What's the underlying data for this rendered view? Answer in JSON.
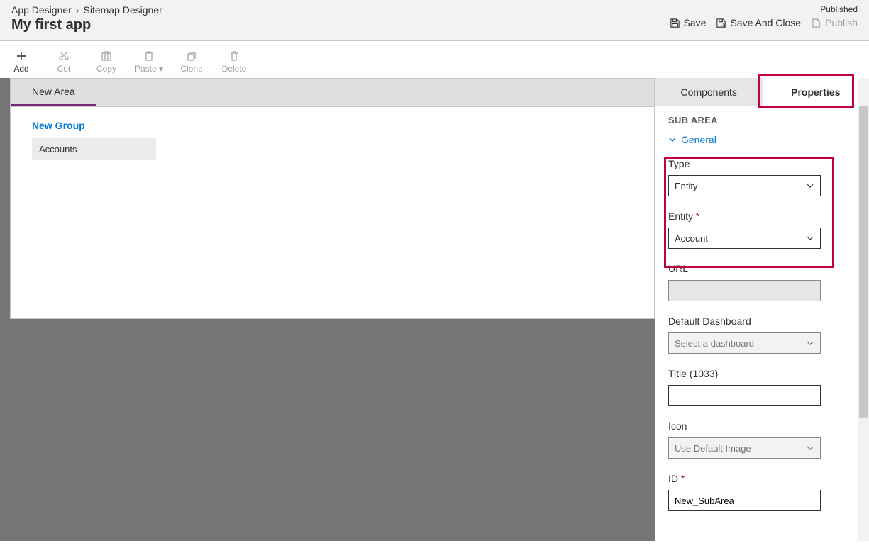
{
  "header": {
    "breadcrumb": [
      "App Designer",
      "Sitemap Designer"
    ],
    "app_title": "My first app",
    "status": "Published",
    "actions": {
      "save": "Save",
      "save_close": "Save And Close",
      "publish": "Publish"
    }
  },
  "toolbar": {
    "add": "Add",
    "cut": "Cut",
    "copy": "Copy",
    "paste": "Paste",
    "clone": "Clone",
    "delete": "Delete"
  },
  "canvas": {
    "area": "New Area",
    "group": "New Group",
    "subarea": "Accounts"
  },
  "panel": {
    "tabs": {
      "components": "Components",
      "properties": "Properties"
    },
    "section": "SUB AREA",
    "general": "General",
    "fields": {
      "type_label": "Type",
      "type_value": "Entity",
      "entity_label": "Entity",
      "entity_value": "Account",
      "url_label": "URL",
      "url_value": "",
      "dashboard_label": "Default Dashboard",
      "dashboard_placeholder": "Select a dashboard",
      "title_label": "Title (1033)",
      "title_value": "",
      "icon_label": "Icon",
      "icon_value": "Use Default Image",
      "id_label": "ID",
      "id_value": "New_SubArea"
    }
  }
}
